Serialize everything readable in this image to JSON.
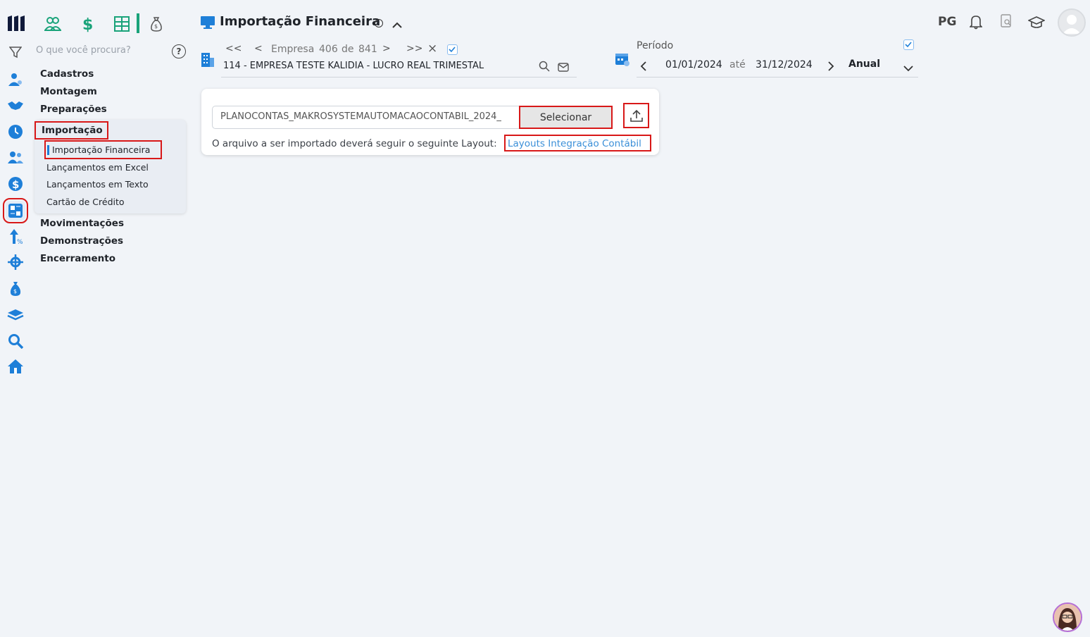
{
  "search": {
    "placeholder": "O que você procura?",
    "help_label": "?"
  },
  "menu": {
    "items_top": [
      "Cadastros",
      "Montagem",
      "Preparações"
    ],
    "active_group": "Importação",
    "sub_items": [
      "Importação Financeira",
      "Lançamentos em Excel",
      "Lançamentos em Texto",
      "Cartão de Crédito"
    ],
    "items_bottom": [
      "Movimentações",
      "Demonstrações",
      "Encerramento"
    ]
  },
  "header": {
    "title": "Importação Financeira",
    "info_glyph": "i"
  },
  "company_nav": {
    "first_btn": "<<",
    "prev_btn": "<",
    "empresa_label": "Empresa",
    "current": "406",
    "de_label": "de",
    "total": "841",
    "next_btn": ">",
    "last_btn": ">>",
    "close_btn": "×",
    "company_name": "114 - EMPRESA TESTE KALIDIA - LUCRO REAL TRIMESTAL"
  },
  "period": {
    "label": "Período",
    "start": "01/01/2024",
    "separator": "até",
    "end": "31/12/2024",
    "mode": "Anual"
  },
  "import": {
    "file_name": "PLANOCONTAS_MAKROSYSTEMAUTOMACAOCONTABIL_2024_",
    "select_label": "Selecionar",
    "layout_text": "O arquivo a ser importado deverá seguir o seguinte Layout:",
    "layout_link": "Layouts Integração Contábil"
  },
  "topbar": {
    "user_initials": "PG"
  },
  "colors": {
    "accent_green": "#1aa37a",
    "accent_blue": "#1e7fd8",
    "highlight_red": "#d81818",
    "link_blue": "#3a8fd8"
  }
}
